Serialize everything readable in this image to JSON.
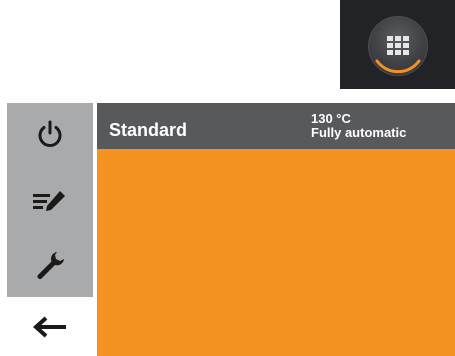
{
  "app_menu": {
    "icon": "grid-icon",
    "accent_color": "#f39220"
  },
  "sidebar": {
    "items": [
      {
        "name": "power",
        "icon": "power-icon"
      },
      {
        "name": "edit",
        "icon": "edit-list-icon"
      },
      {
        "name": "settings",
        "icon": "wrench-icon"
      }
    ],
    "back": {
      "icon": "arrow-left-icon"
    }
  },
  "header": {
    "program_name": "Standard",
    "temperature": "130 °C",
    "mode": "Fully automatic"
  },
  "colors": {
    "header_bg": "#58595b",
    "sidebar_bg": "#a9aaac",
    "content_bg": "#f39220"
  }
}
